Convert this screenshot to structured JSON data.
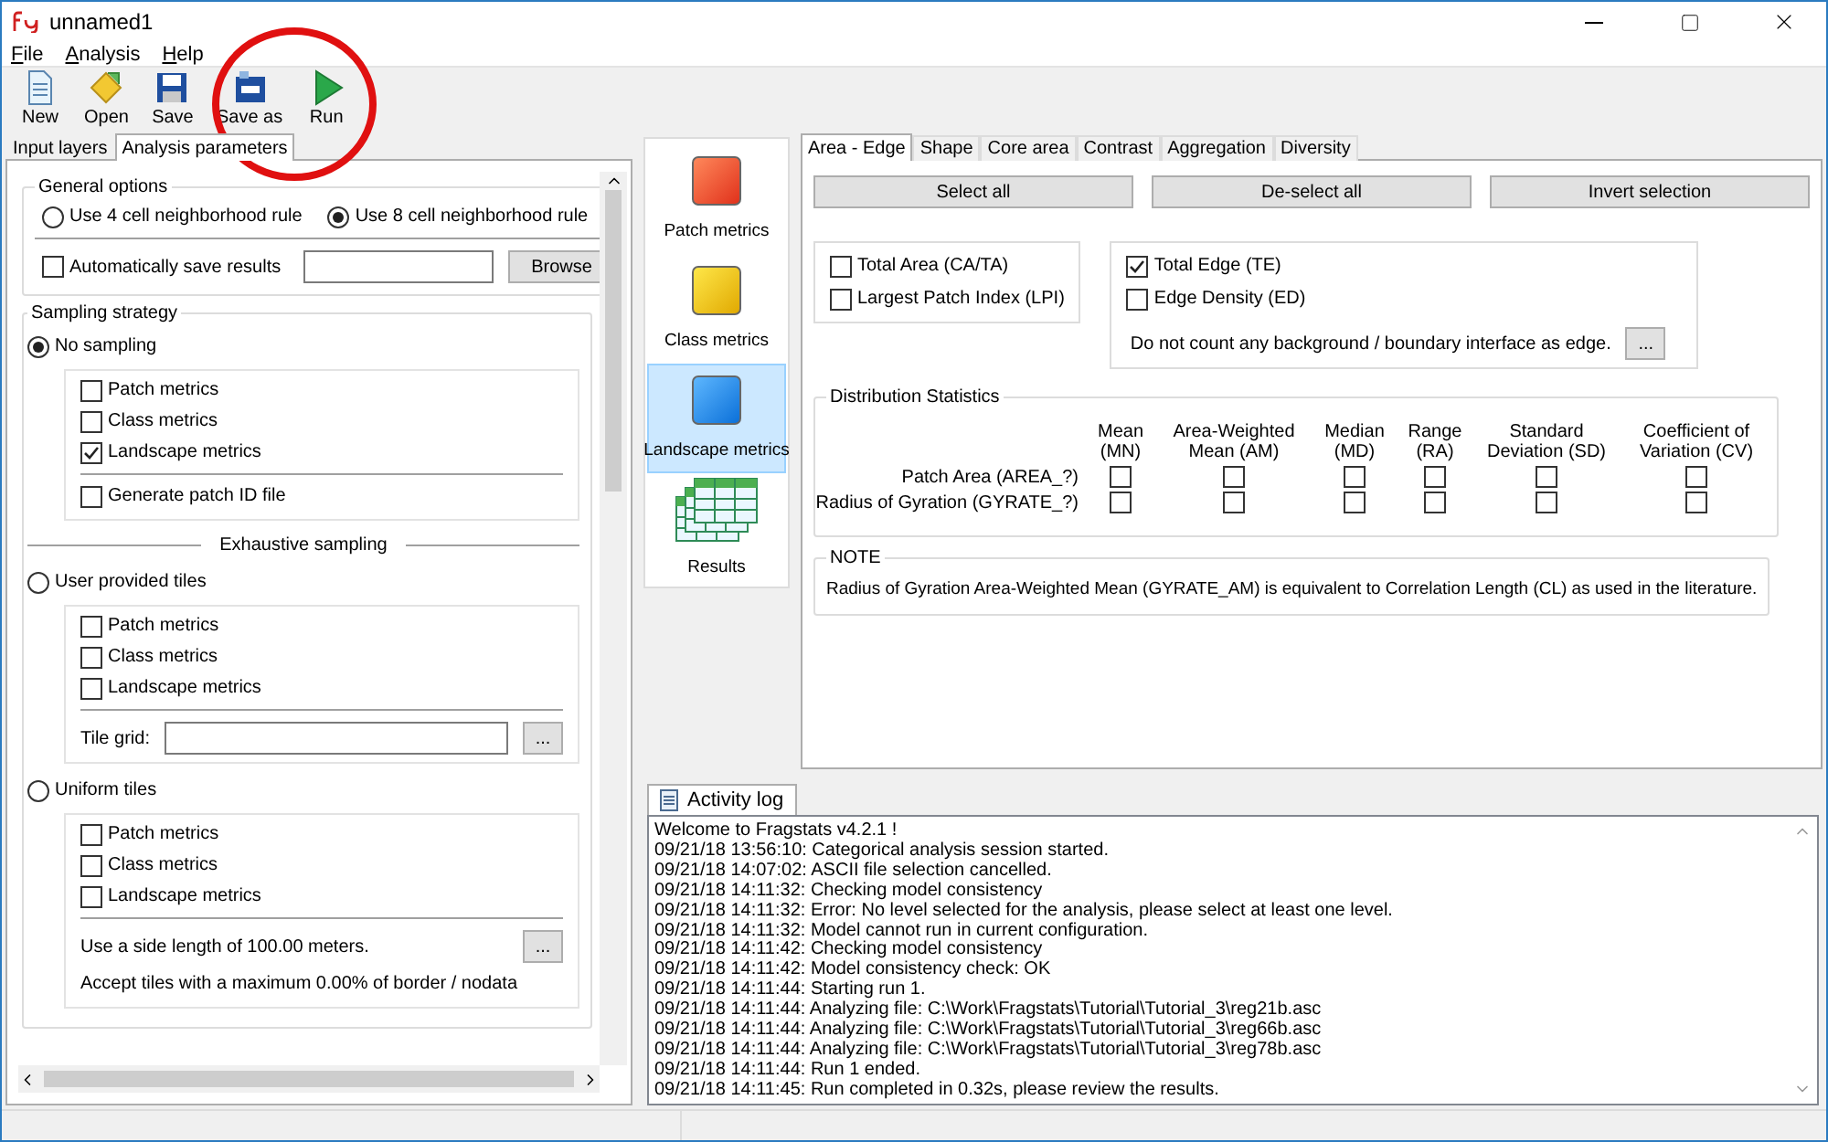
{
  "window": {
    "title": "unnamed1"
  },
  "menu": [
    "File",
    "Analysis",
    "Help"
  ],
  "toolbar": [
    {
      "label": "New",
      "kind": "new"
    },
    {
      "label": "Open",
      "kind": "open"
    },
    {
      "label": "Save",
      "kind": "save"
    },
    {
      "label": "Save as",
      "kind": "saveas"
    },
    {
      "label": "Run",
      "kind": "run"
    }
  ],
  "left_tabs": [
    {
      "label": "Input layers",
      "selected": false
    },
    {
      "label": "Analysis parameters",
      "selected": true
    }
  ],
  "general_options": {
    "title": "General options",
    "neighborhood": [
      {
        "label": "Use 4 cell neighborhood rule",
        "selected": false
      },
      {
        "label": "Use 8 cell neighborhood rule",
        "selected": true
      }
    ],
    "auto_save": {
      "label": "Automatically save results",
      "checked": false
    },
    "browse": "Browse"
  },
  "sampling": {
    "title": "Sampling strategy",
    "options": [
      {
        "label": "No sampling",
        "selected": true,
        "metrics": [
          {
            "label": "Patch metrics",
            "checked": false
          },
          {
            "label": "Class metrics",
            "checked": false
          },
          {
            "label": "Landscape metrics",
            "checked": true
          }
        ],
        "extras": [
          {
            "kind": "checkbox",
            "label": "Generate patch ID file",
            "checked": false
          }
        ]
      },
      {
        "heading": "Exhaustive sampling",
        "label": "User provided tiles",
        "selected": false,
        "metrics": [
          {
            "label": "Patch metrics",
            "checked": false
          },
          {
            "label": "Class metrics",
            "checked": false
          },
          {
            "label": "Landscape metrics",
            "checked": false
          }
        ],
        "extras": [
          {
            "kind": "file",
            "label": "Tile grid:",
            "button": "..."
          }
        ]
      },
      {
        "label": "Uniform tiles",
        "selected": false,
        "metrics": [
          {
            "label": "Patch metrics",
            "checked": false
          },
          {
            "label": "Class metrics",
            "checked": false
          },
          {
            "label": "Landscape metrics",
            "checked": false
          }
        ],
        "extras": [
          {
            "kind": "setting",
            "label": "Use a side length of 100.00 meters.",
            "button": "..."
          },
          {
            "kind": "setting",
            "label": "Accept tiles with a maximum 0.00% of border / nodata"
          }
        ]
      }
    ]
  },
  "levels": [
    {
      "label": "Patch metrics",
      "kind": "patch",
      "selected": false
    },
    {
      "label": "Class metrics",
      "kind": "class",
      "selected": false
    },
    {
      "label": "Landscape metrics",
      "kind": "landscape",
      "selected": true
    },
    {
      "label": "Results",
      "kind": "results",
      "selected": false
    }
  ],
  "metric_tabs": [
    {
      "label": "Area - Edge",
      "selected": true
    },
    {
      "label": "Shape",
      "selected": false
    },
    {
      "label": "Core area",
      "selected": false
    },
    {
      "label": "Contrast",
      "selected": false
    },
    {
      "label": "Aggregation",
      "selected": false
    },
    {
      "label": "Diversity",
      "selected": false
    }
  ],
  "selection_buttons": [
    "Select all",
    "De-select all",
    "Invert selection"
  ],
  "area_metrics": [
    {
      "label": "Total Area  (CA/TA)",
      "checked": false
    },
    {
      "label": "Largest Patch Index  (LPI)",
      "checked": false
    }
  ],
  "edge_metrics": {
    "items": [
      {
        "label": "Total Edge  (TE)",
        "checked": true
      },
      {
        "label": "Edge Density  (ED)",
        "checked": false
      }
    ],
    "note": "Do not count any background / boundary interface as edge.",
    "button": "..."
  },
  "distribution": {
    "title": "Distribution Statistics",
    "columns": [
      "Mean\n(MN)",
      "Area-Weighted\nMean (AM)",
      "Median\n(MD)",
      "Range\n(RA)",
      "Standard\nDeviation (SD)",
      "Coefficient of\nVariation (CV)"
    ],
    "rows": [
      {
        "label": "Patch Area (AREA_?)",
        "checks": [
          false,
          false,
          false,
          false,
          false,
          false
        ]
      },
      {
        "label": "Radius of Gyration (GYRATE_?)",
        "checks": [
          false,
          false,
          false,
          false,
          false,
          false
        ]
      }
    ]
  },
  "note": {
    "title": "NOTE",
    "text": "Radius of Gyration Area-Weighted Mean (GYRATE_AM) is equivalent to Correlation Length (CL) as used in the literature."
  },
  "activity_log": {
    "tab": "Activity log",
    "lines": [
      "Welcome to Fragstats v4.2.1 !",
      "09/21/18 13:56:10: Categorical analysis session started.",
      "09/21/18 14:07:02: ASCII file selection cancelled.",
      "09/21/18 14:11:32: Checking model consistency",
      "09/21/18 14:11:32: Error: No level selected for the analysis, please select at least one level.",
      "09/21/18 14:11:32: Model cannot run in current configuration.",
      "09/21/18 14:11:42: Checking model consistency",
      "09/21/18 14:11:42: Model consistency check: OK",
      "09/21/18 14:11:44: Starting run 1.",
      "09/21/18 14:11:44: Analyzing file: C:\\Work\\Fragstats\\Tutorial\\Tutorial_3\\reg21b.asc",
      "09/21/18 14:11:44: Analyzing file: C:\\Work\\Fragstats\\Tutorial\\Tutorial_3\\reg66b.asc",
      "09/21/18 14:11:44: Analyzing file: C:\\Work\\Fragstats\\Tutorial\\Tutorial_3\\reg78b.asc",
      "09/21/18 14:11:44: Run 1 ended.",
      "09/21/18 14:11:45: Run completed in 0.32s, please review the results."
    ]
  }
}
